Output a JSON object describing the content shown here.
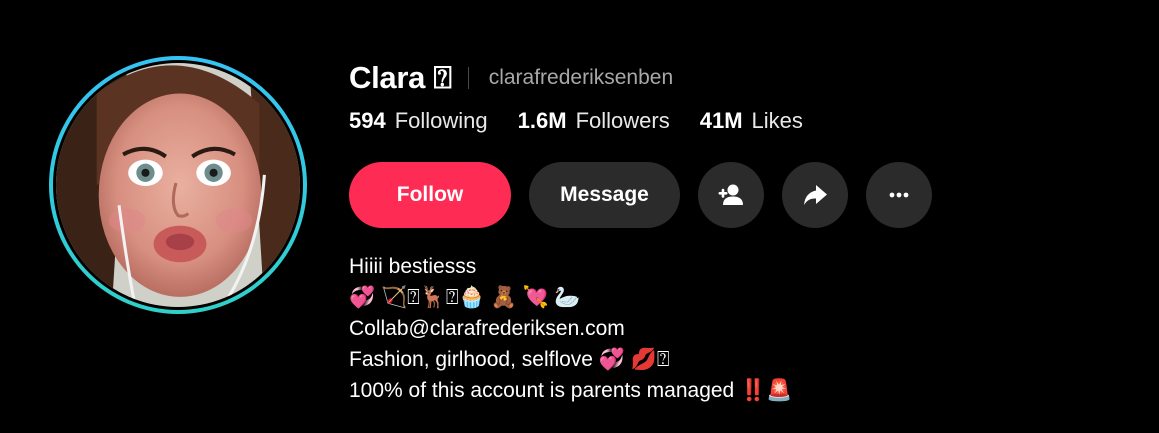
{
  "profile": {
    "display_name": "Clara",
    "name_glyph": "⍰",
    "username": "clarafrederiksenben",
    "avatar_description": "profile photo"
  },
  "stats": [
    {
      "value": "594",
      "label": "Following"
    },
    {
      "value": "1.6M",
      "label": "Followers"
    },
    {
      "value": "41M",
      "label": "Likes"
    }
  ],
  "actions": {
    "follow_label": "Follow",
    "message_label": "Message",
    "add_friend_icon": "add-person-icon",
    "share_icon": "share-arrow-icon",
    "more_icon": "more-dots-icon"
  },
  "bio": {
    "lines": [
      "Hiiii bestiesss",
      "💞 🏹⍰🦌⍰🧁 🧸 💘 🦢",
      "Collab@clarafrederiksen.com",
      "Fashion, girlhood, selflove 💞 💋⍰",
      "100% of this account is parents managed ‼️🚨"
    ]
  },
  "colors": {
    "follow_button": "#fe2c55",
    "secondary_button": "#2b2b2b",
    "avatar_ring": "#35c3f5",
    "username_text": "#a8a8a8",
    "background": "#000000"
  }
}
